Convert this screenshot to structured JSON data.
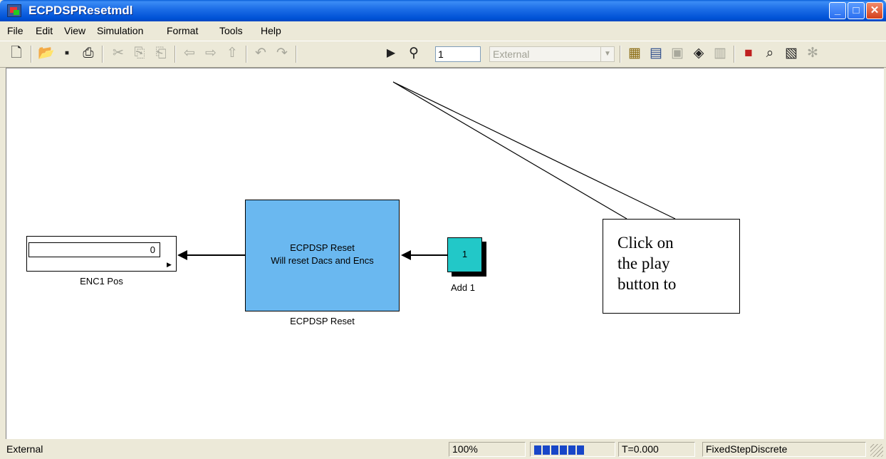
{
  "window": {
    "title": "ECPDSPResetmdl",
    "controls": [
      "_",
      "□",
      "✕"
    ]
  },
  "menu": [
    "File",
    "Edit",
    "View",
    "Simulation",
    "Format",
    "Tools",
    "Help"
  ],
  "toolbar": {
    "stop_time": "1",
    "sim_mode": "External",
    "icons": [
      "new-model-icon",
      "open-icon",
      "save-icon",
      "print-icon",
      "cut-icon",
      "copy-icon",
      "paste-icon",
      "back-icon",
      "forward-icon",
      "up-icon",
      "undo-icon",
      "redo-icon",
      "play-icon",
      "build-icon",
      "connect-icon",
      "update-icon",
      "library-icon",
      "model-explorer-icon",
      "debugger-icon",
      "profiler-icon"
    ]
  },
  "blocks": {
    "display": {
      "value": "0",
      "label": "ENC1 Pos"
    },
    "reset": {
      "line1": "ECPDSP Reset",
      "line2": "Will reset Dacs and Encs",
      "label": "ECPDSP Reset"
    },
    "constant": {
      "value": "1",
      "label": "Add 1"
    }
  },
  "callout": {
    "line1": "Click on",
    "line2": "the play",
    "line3": "button to"
  },
  "status": {
    "mode": "External",
    "zoom": "100%",
    "progress": 1.0,
    "time": "T=0.000",
    "solver": "FixedStepDiscrete"
  },
  "colors": {
    "title_bar": "#0052d6",
    "reset_block": "#6ab8f0",
    "constant_block": "#22c8c8",
    "progress": "#1846c8"
  }
}
